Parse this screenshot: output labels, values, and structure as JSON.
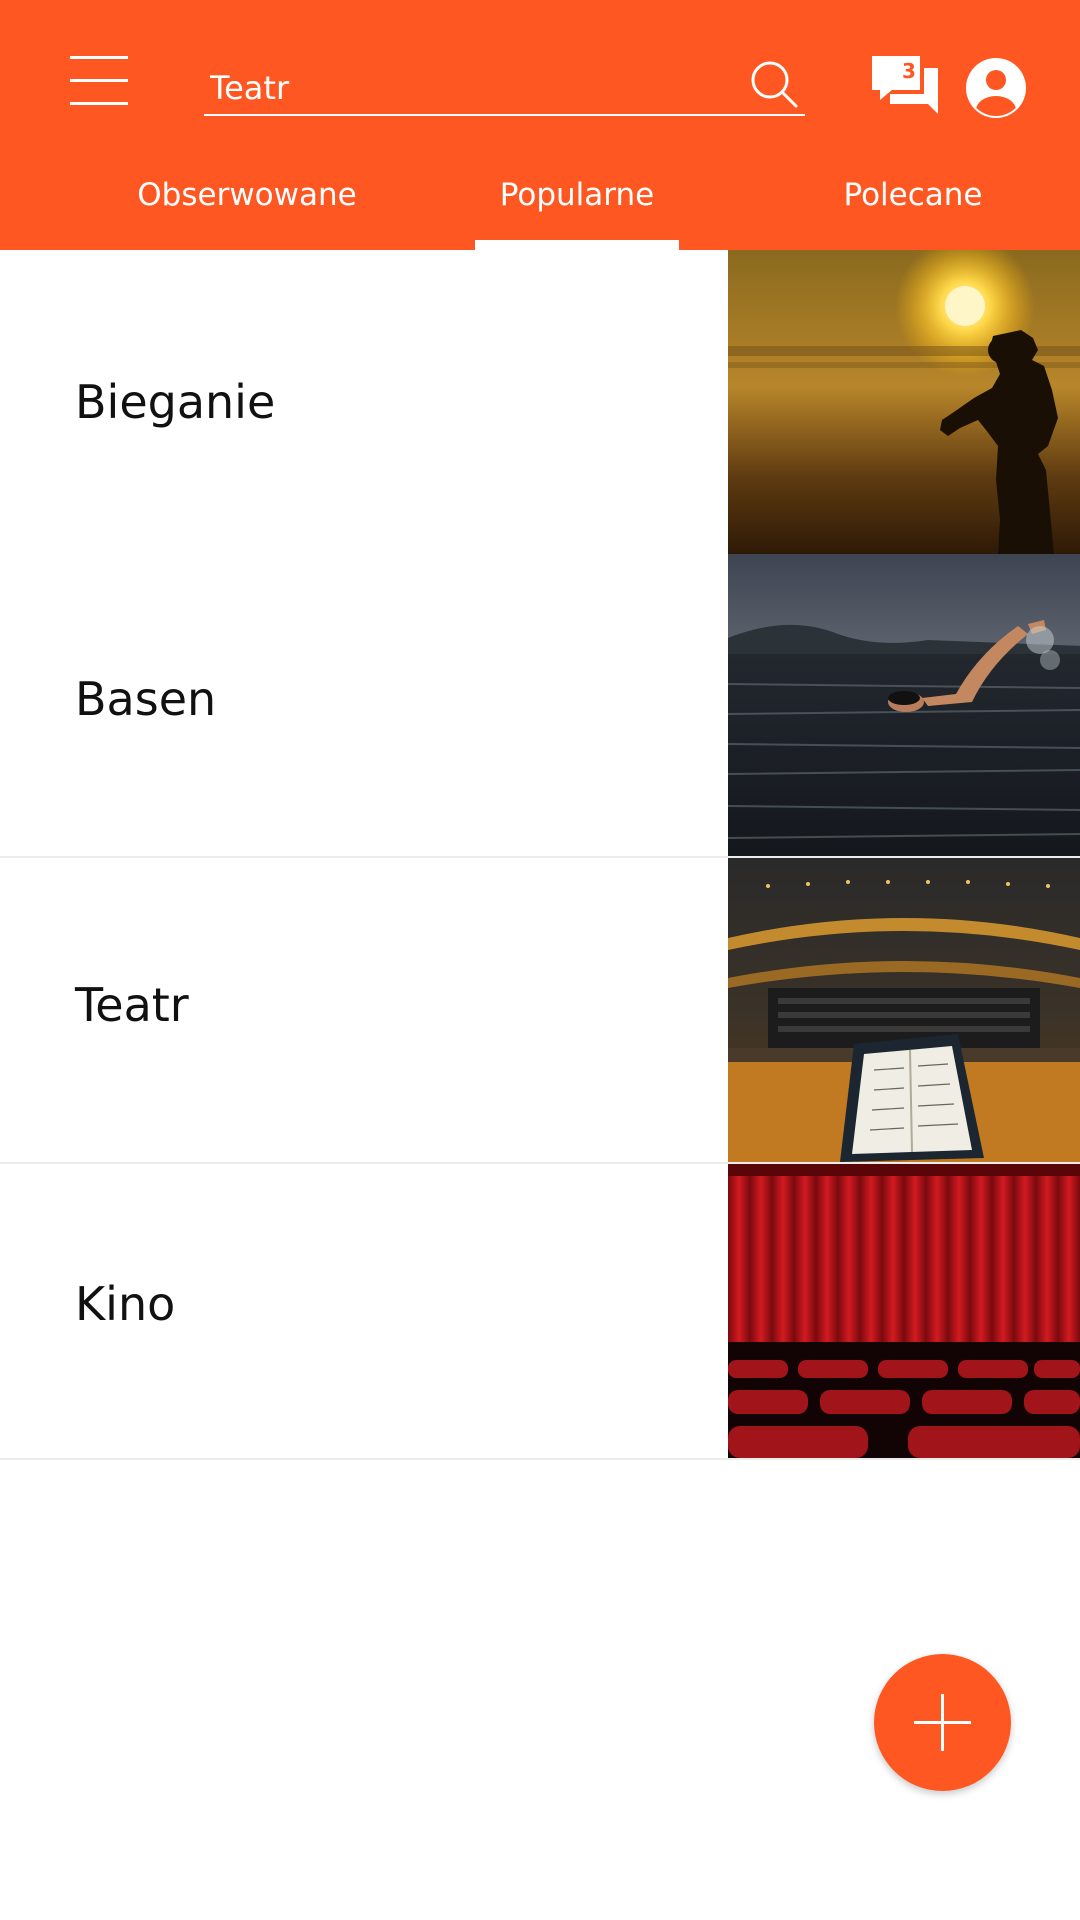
{
  "search": {
    "value": "Teatr"
  },
  "header": {
    "messages_count": "3"
  },
  "tabs": [
    {
      "label": "Obserwowane",
      "active": false
    },
    {
      "label": "Popularne",
      "active": true
    },
    {
      "label": "Polecane",
      "active": false
    }
  ],
  "list": {
    "items": [
      {
        "label": "Bieganie",
        "image": "runner-silhouette-sunset"
      },
      {
        "label": "Basen",
        "image": "swimmer-in-water"
      },
      {
        "label": "Teatr",
        "image": "concert-hall-interior"
      },
      {
        "label": "Kino",
        "image": "red-curtain-cinema-seats"
      }
    ]
  },
  "colors": {
    "accent": "#FF5722",
    "text": "#111111",
    "background": "#FFFFFF"
  },
  "icons": [
    "menu-icon",
    "search-icon",
    "messages-icon",
    "profile-icon",
    "plus-icon"
  ]
}
